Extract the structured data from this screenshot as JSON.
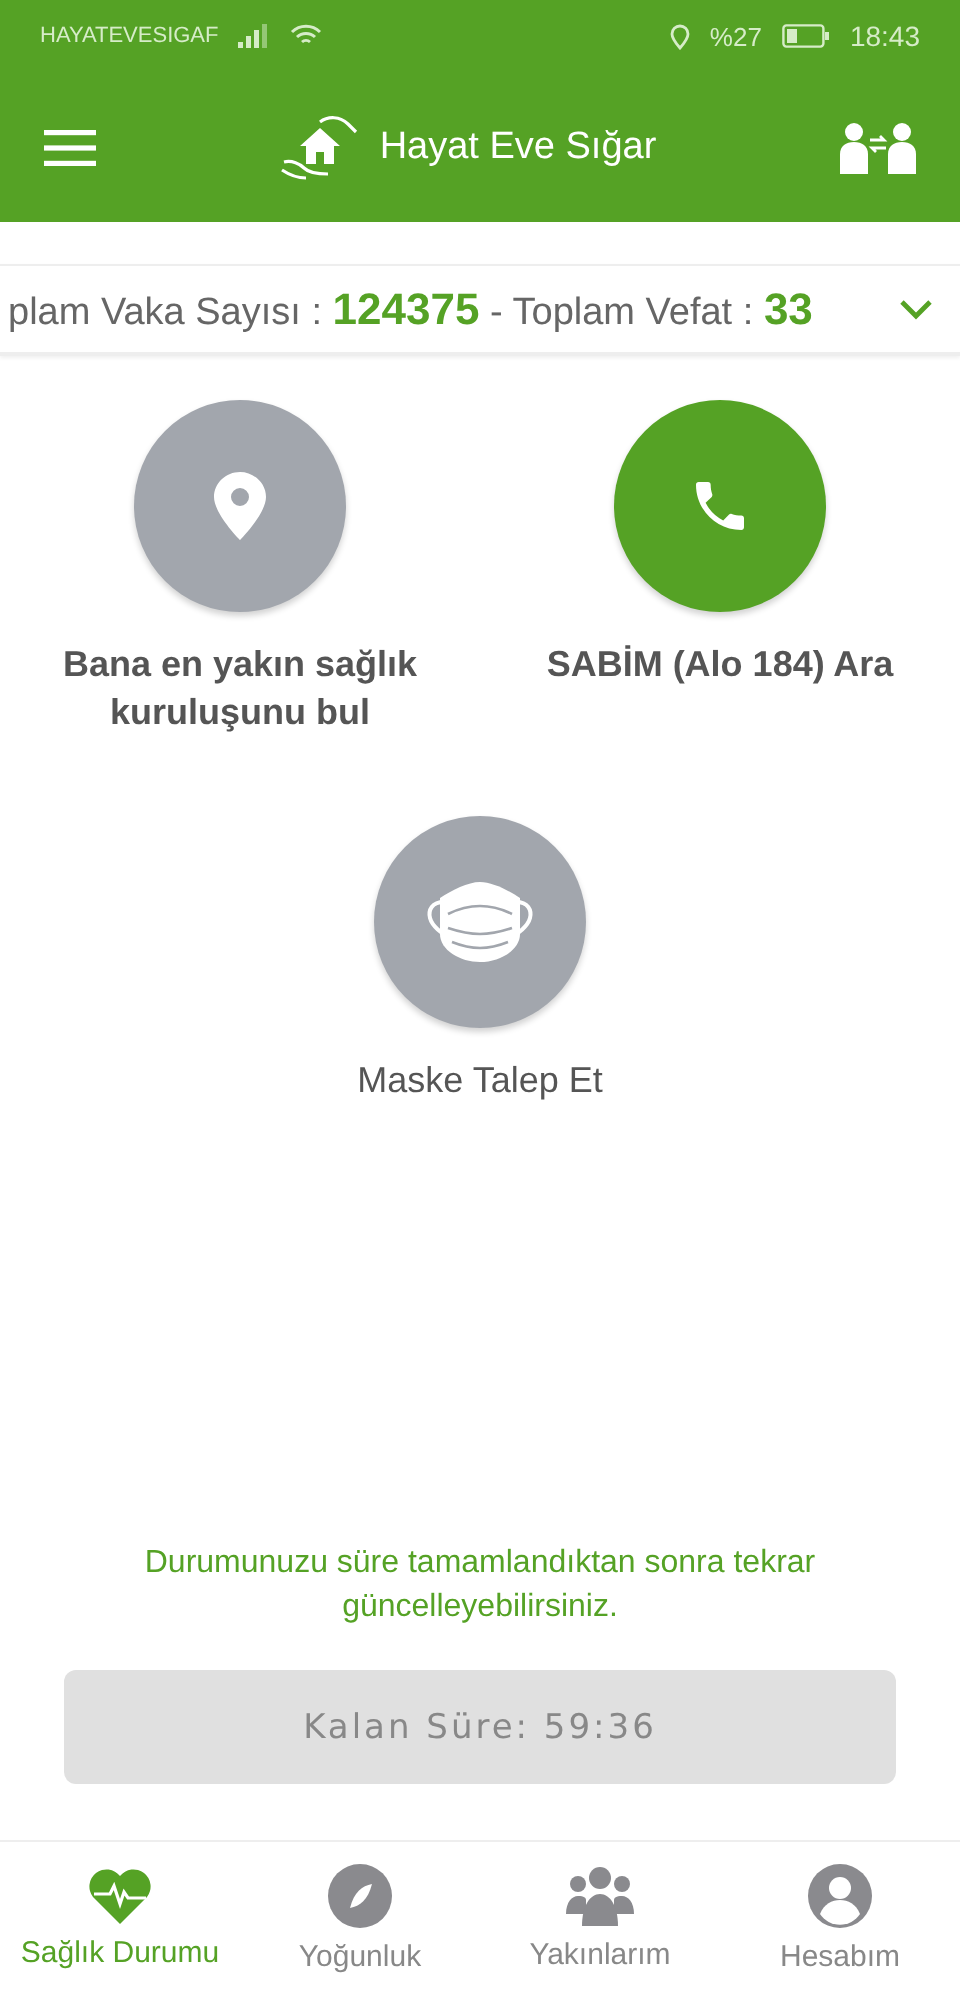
{
  "status_bar": {
    "carrier": "HAYATEVESIGAF",
    "battery_text": "%27",
    "time": "18:43"
  },
  "app_bar": {
    "title": "Hayat Eve Sığar"
  },
  "ticker": {
    "cases_label": "plam Vaka Sayısı :",
    "cases_value": "124375",
    "deaths_label": "- Toplam Vefat :",
    "deaths_value": "33"
  },
  "actions": [
    {
      "kind": "location",
      "label": "Bana en yakın sağlık kuruluşunu bul",
      "color": "#a2a6ad"
    },
    {
      "kind": "phone",
      "label": "SABİM (Alo 184) Ara",
      "color": "#55a225"
    },
    {
      "kind": "mask",
      "label": "Maske Talep Et",
      "color": "#a2a6ad"
    }
  ],
  "notice": "Durumunuzu süre tamamlandıktan sonra tekrar güncelleyebilirsiniz.",
  "timer_button": {
    "label": "Kalan Süre: 59:36",
    "disabled": true
  },
  "bottom_nav": [
    {
      "kind": "heart",
      "label": "Sağlık Durumu",
      "selected": true
    },
    {
      "kind": "compass",
      "label": "Yoğunluk",
      "selected": false
    },
    {
      "kind": "people",
      "label": "Yakınlarım",
      "selected": false
    },
    {
      "kind": "account",
      "label": "Hesabım",
      "selected": false
    }
  ]
}
